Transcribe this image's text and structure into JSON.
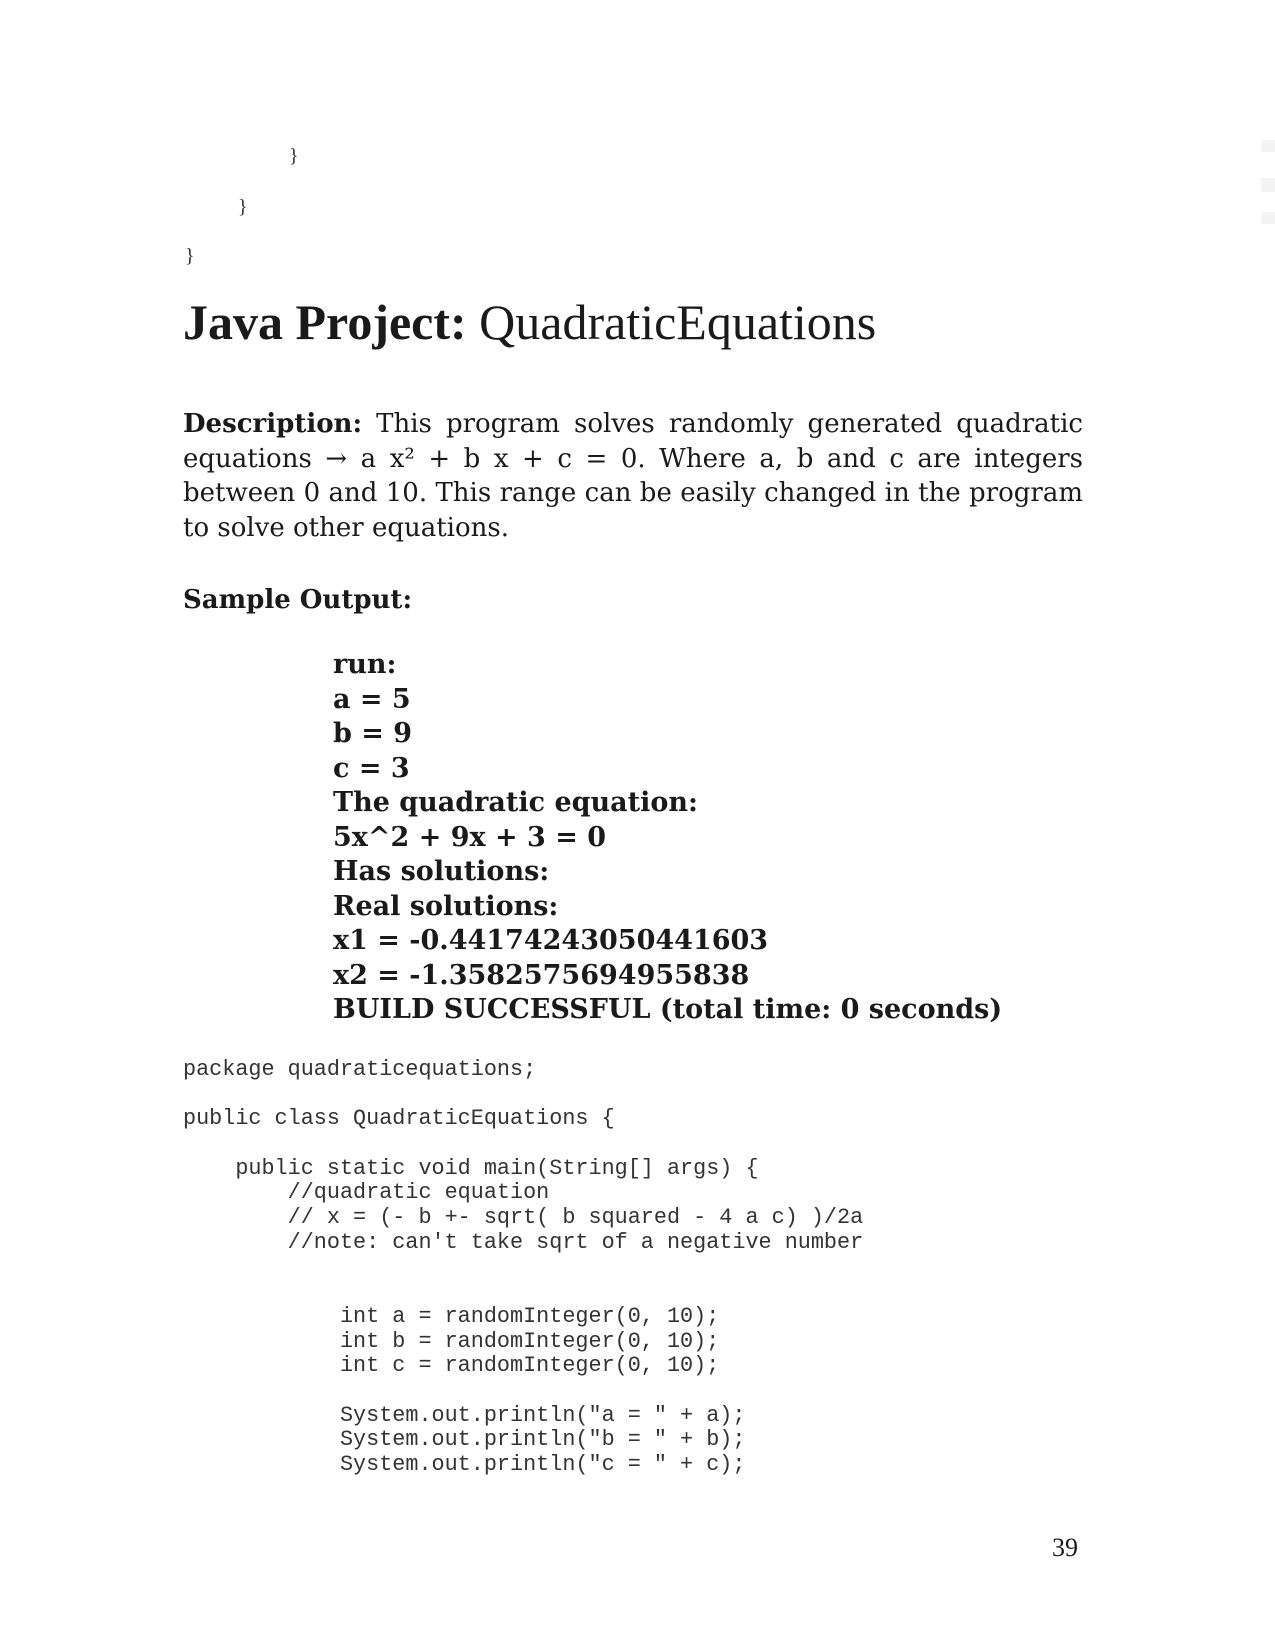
{
  "braces": [
    "}",
    "}",
    "}"
  ],
  "title": {
    "label": "Java Project:",
    "name": "QuadraticEquations"
  },
  "description": {
    "label": "Description:",
    "text": "This program solves randomly generated quadratic equations → a x² + b x + c = 0. Where a, b and c are integers between 0 and 10. This range can be easily changed in the program to solve other equations."
  },
  "sample_output": {
    "heading": "Sample Output:",
    "lines": [
      "run:",
      "a = 5",
      "b = 9",
      "c = 3",
      "The quadratic equation:",
      "5x^2 + 9x + 3 = 0",
      "Has solutions:",
      "Real solutions:",
      "x1 = -0.44174243050441603",
      "x2 = -1.3582575694955838",
      "BUILD SUCCESSFUL (total time: 0 seconds)"
    ]
  },
  "code": {
    "lines": [
      "package quadraticequations;",
      "",
      "public class QuadraticEquations {",
      "",
      "    public static void main(String[] args) {",
      "        //quadratic equation",
      "        // x = (- b +- sqrt( b squared - 4 a c) )/2a",
      "        //note: can't take sqrt of a negative number",
      "",
      "",
      "            int a = randomInteger(0, 10);",
      "            int b = randomInteger(0, 10);",
      "            int c = randomInteger(0, 10);",
      "",
      "            System.out.println(\"a = \" + a);",
      "            System.out.println(\"b = \" + b);",
      "            System.out.println(\"c = \" + c);"
    ]
  },
  "page_number": "39"
}
